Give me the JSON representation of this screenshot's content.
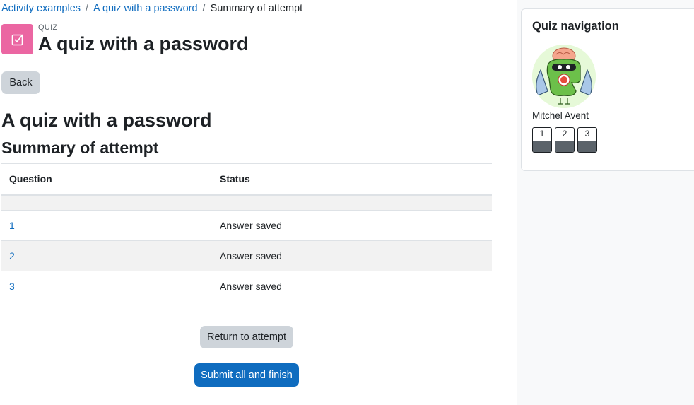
{
  "breadcrumb": {
    "items": [
      "Activity examples",
      "A quiz with a password"
    ],
    "current": "Summary of attempt"
  },
  "header": {
    "activity_type": "QUIZ",
    "title": "A quiz with a password",
    "icon": "quiz-checkbox-icon",
    "icon_color": "#eb66a2"
  },
  "back_label": "Back",
  "page_heading": "A quiz with a password",
  "summary_heading": "Summary of attempt",
  "table": {
    "headers": [
      "Question",
      "Status"
    ],
    "rows": [
      {
        "question": "1",
        "status": "Answer saved"
      },
      {
        "question": "2",
        "status": "Answer saved"
      },
      {
        "question": "3",
        "status": "Answer saved"
      }
    ]
  },
  "actions": {
    "return_label": "Return to attempt",
    "submit_label": "Submit all and finish"
  },
  "quiz_nav": {
    "title": "Quiz navigation",
    "user_name": "Mitchel Avent",
    "avatar_icon": "user-avatar-icon",
    "questions": [
      "1",
      "2",
      "3"
    ]
  },
  "colors": {
    "primary": "#0f6cbf",
    "secondary": "#ced4da",
    "link": "#0f6cbf",
    "drawer_bg": "#f8f9fa"
  }
}
